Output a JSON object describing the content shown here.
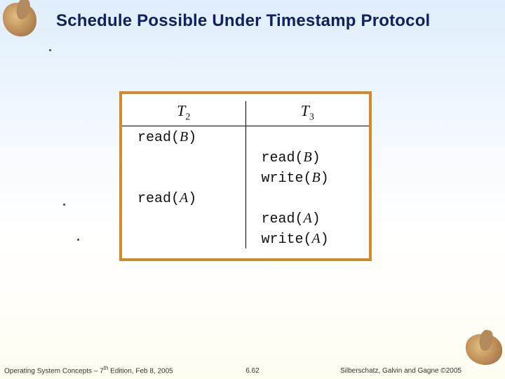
{
  "title": "Schedule Possible Under Timestamp Protocol",
  "schedule": {
    "headers": {
      "t2": "T",
      "t2sub": "2",
      "t3": "T",
      "t3sub": "3"
    },
    "rows": [
      {
        "left_op": "read",
        "left_var": "B",
        "right_op": "",
        "right_var": ""
      },
      {
        "left_op": "",
        "left_var": "",
        "right_op": "read",
        "right_var": "B"
      },
      {
        "left_op": "",
        "left_var": "",
        "right_op": "write",
        "right_var": "B"
      },
      {
        "left_op": "read",
        "left_var": "A",
        "right_op": "",
        "right_var": ""
      },
      {
        "left_op": "",
        "left_var": "",
        "right_op": "read",
        "right_var": "A"
      },
      {
        "left_op": "",
        "left_var": "",
        "right_op": "write",
        "right_var": "A"
      }
    ]
  },
  "footer": {
    "left_prefix": "Operating System Concepts – 7",
    "left_sup": "th",
    "left_suffix": " Edition, Feb 8, 2005",
    "center": "6.62",
    "right": "Silberschatz, Galvin and Gagne ©2005"
  }
}
